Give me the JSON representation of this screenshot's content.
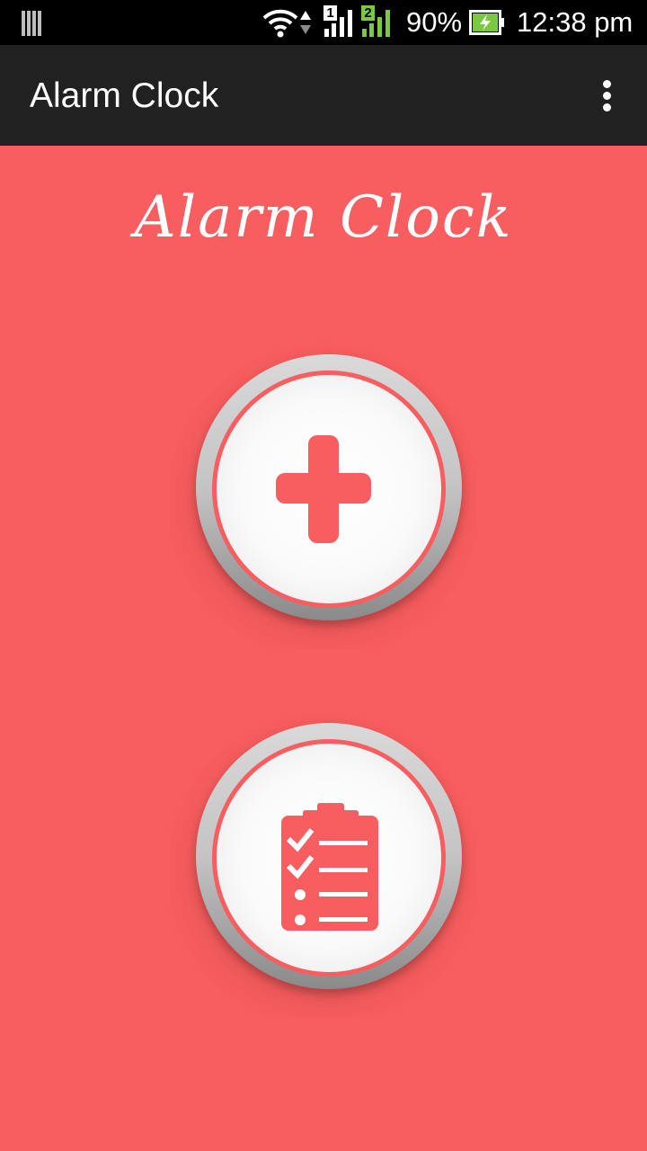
{
  "status_bar": {
    "battery_percent": "90%",
    "time": "12:38 pm",
    "sim1_label": "1",
    "sim2_label": "2",
    "icons": [
      "notification-bars-icon",
      "wifi-icon",
      "data-arrows-icon",
      "sim1-signal-icon",
      "sim2-signal-icon",
      "battery-charging-icon"
    ]
  },
  "action_bar": {
    "title": "Alarm Clock",
    "overflow_icon": "overflow-menu-icon"
  },
  "main": {
    "script_title": "Alarm Clock",
    "add_button_icon": "plus-icon",
    "list_button_icon": "clipboard-checklist-icon"
  },
  "colors": {
    "background": "#f85d5f",
    "action_bar": "#212121",
    "status_bar": "#000000",
    "accent": "#f85d5f",
    "sim2_green": "#7ac943"
  }
}
